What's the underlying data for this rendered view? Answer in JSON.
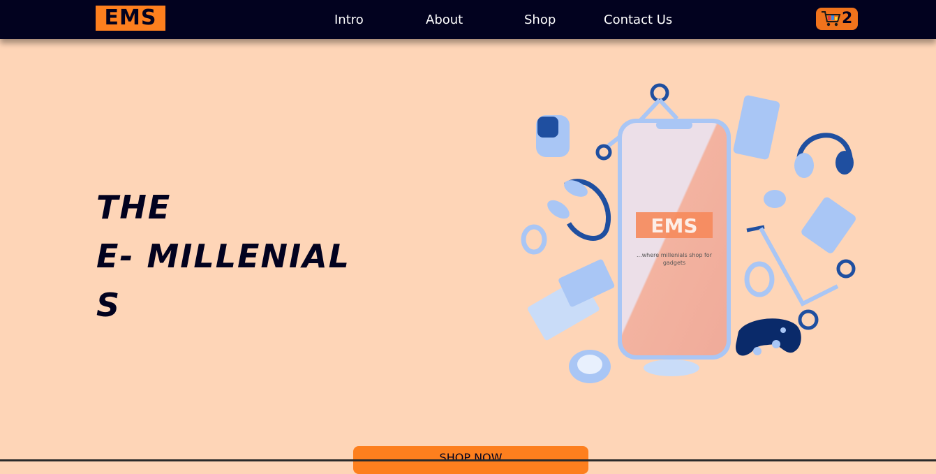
{
  "nav": {
    "logo": "EMS",
    "links": [
      "Intro",
      "About",
      "Shop",
      "Contact Us"
    ],
    "cart_count": "2"
  },
  "hero": {
    "title_lines": [
      "THE",
      "E- MILLENIAL",
      "S"
    ],
    "phone_logo": "EMS",
    "phone_tagline_1": "...where millenials shop for",
    "phone_tagline_2": "gadgets"
  },
  "cta": {
    "label": "SHOP NOW"
  },
  "colors": {
    "accent": "#fd7f1e",
    "navbar": "#02021f",
    "background": "#fed5b7",
    "gadget_blue": "#a9c6f5",
    "gadget_dark": "#1f4fa0"
  },
  "icons": {
    "cart": "shopping-cart-icon"
  }
}
